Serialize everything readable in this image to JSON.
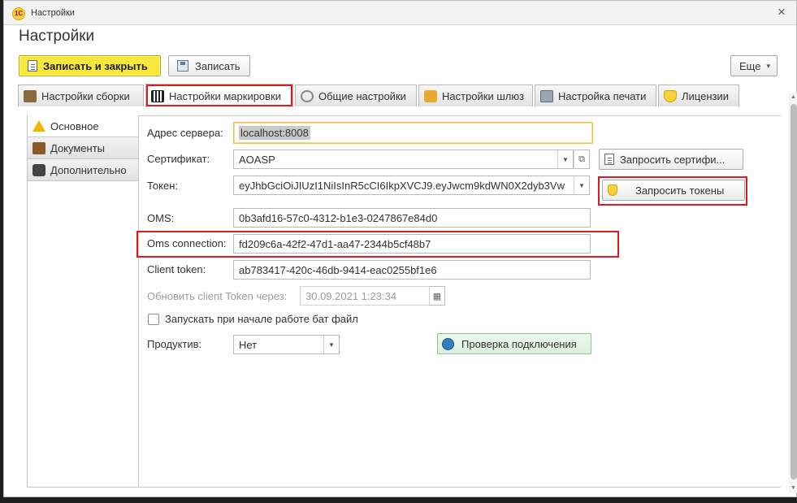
{
  "window": {
    "title": "Настройки",
    "app_logo": "1С",
    "close": "×"
  },
  "form_title": "Настройки",
  "toolbar": {
    "save_close_label": "Записать и закрыть",
    "save_label": "Записать",
    "more_label": "Еще",
    "more_caret": "▾"
  },
  "tabs": [
    {
      "label": "Настройки сборки",
      "icon": "build-settings-icon"
    },
    {
      "label": "Настройки маркировки",
      "icon": "qr-code-icon"
    },
    {
      "label": "Общие настройки",
      "icon": "gear-icon"
    },
    {
      "label": "Настройки шлюз",
      "icon": "gateway-icon"
    },
    {
      "label": "Настройка печати",
      "icon": "printer-icon"
    },
    {
      "label": "Лицензии",
      "icon": "license-icon"
    }
  ],
  "side_nav": [
    {
      "label": "Основное",
      "icon": "warning-icon"
    },
    {
      "label": "Документы",
      "icon": "briefcase-icon"
    },
    {
      "label": "Дополнительно",
      "icon": "chat-icon"
    }
  ],
  "form": {
    "server_label": "Адрес сервера:",
    "server_value": "localhost:8008",
    "cert_label": "Сертификат:",
    "cert_value": "AOASP",
    "request_cert_label": "Запросить сертифи...",
    "token_label": "Токен:",
    "token_value": "eyJhbGciOiJIUzI1NiIsInR5cCI6IkpXVCJ9.eyJwcm9kdWN0X2dyb3Vw",
    "request_tokens_label": "Запросить токены",
    "oms_label": "OMS:",
    "oms_value": "0b3afd16-57c0-4312-b1e3-0247867e84d0",
    "oms_conn_label": "Oms connection:",
    "oms_conn_value": "fd209c6a-42f2-47d1-aa47-2344b5cf48b7",
    "client_token_label": "Client token:",
    "client_token_value": "ab783417-420c-46db-9414-eac0255bf1e6",
    "refresh_label": "Обновить client Token через:",
    "refresh_value": "30.09.2021  1:23:34",
    "bat_label": "Запускать при начале работе бат файл",
    "prod_label": "Продуктив:",
    "prod_value": "Нет",
    "check_conn_label": "Проверка подключения"
  },
  "colors": {
    "primary_button": "#f8e73d",
    "highlight": "#e2191f",
    "focus_border": "#efc24a",
    "connection_button": "#e6f4e6"
  }
}
